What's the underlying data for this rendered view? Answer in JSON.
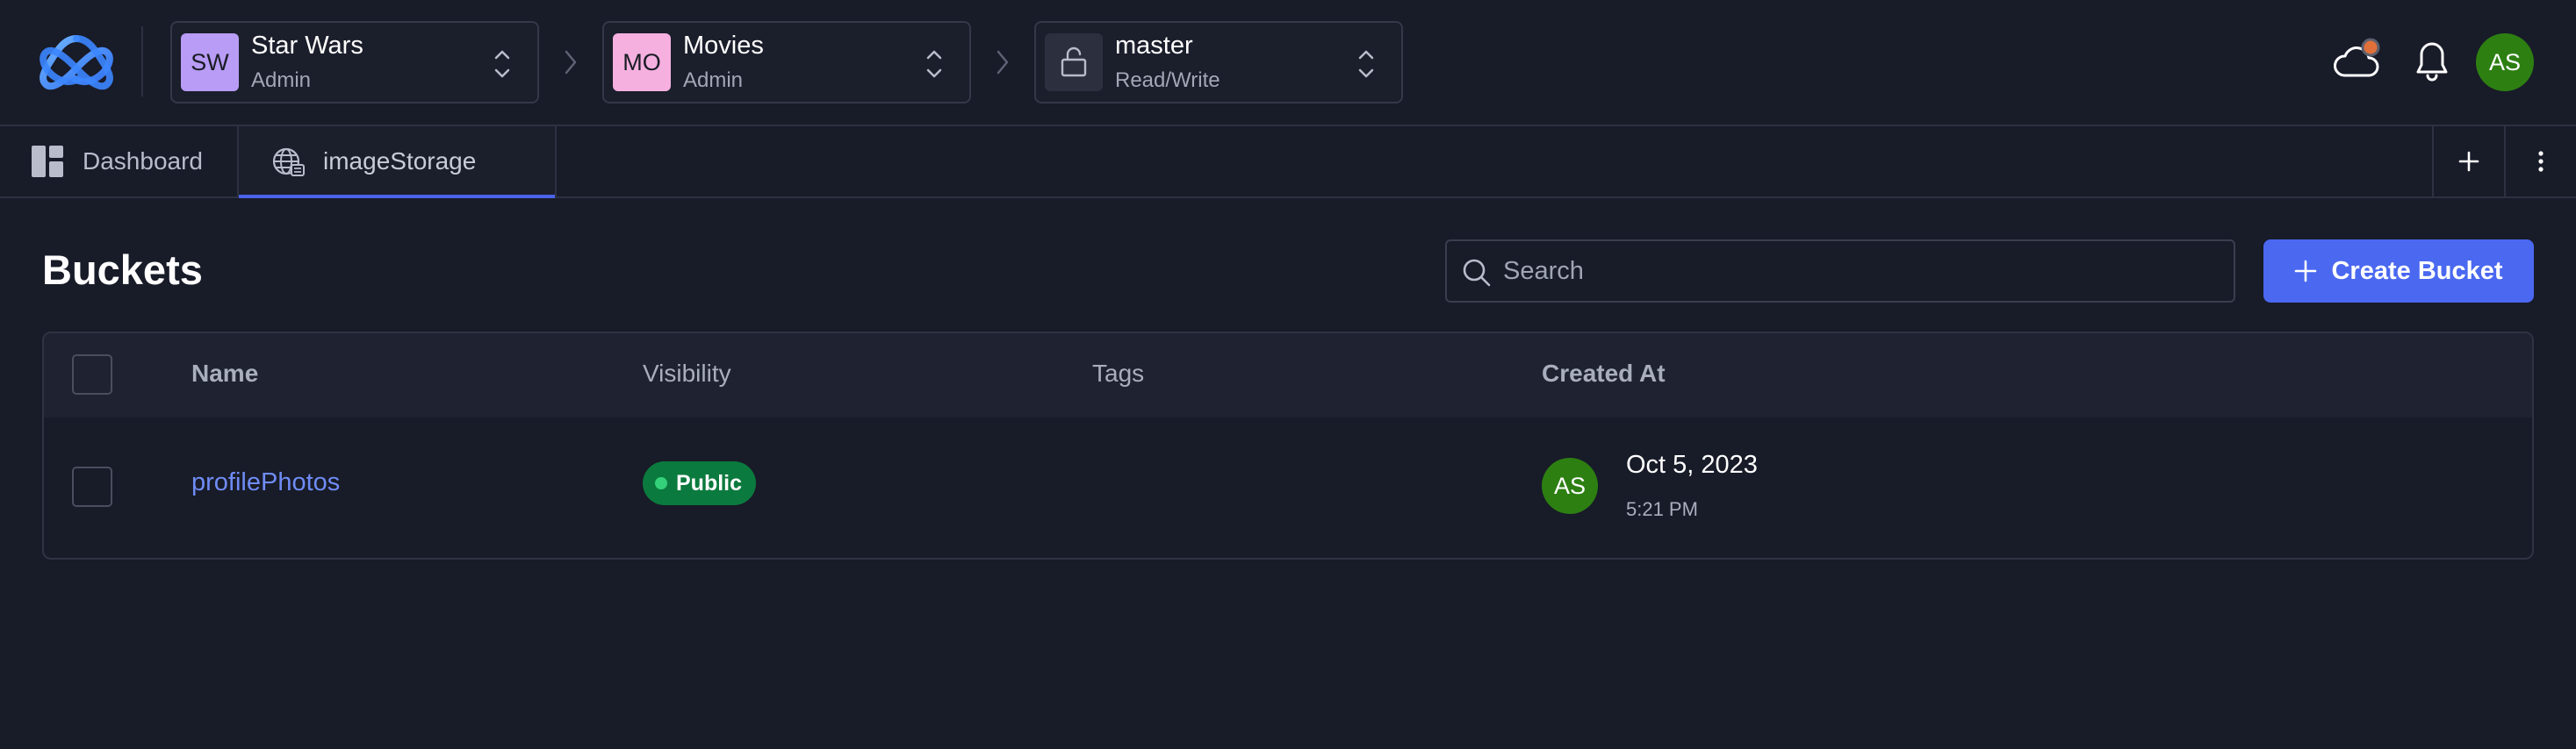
{
  "colors": {
    "background": "#181b28",
    "accent": "#4a68f0",
    "link": "#6f8cf5",
    "public_badge": "#0b7a3e",
    "user_avatar": "#2d7f12",
    "notification_dot": "#e0703a"
  },
  "header": {
    "breadcrumbs": [
      {
        "initials": "SW",
        "name": "Star Wars",
        "role": "Admin",
        "avatar_color": "#b89cf5",
        "icon": "chevron-updown-icon"
      },
      {
        "initials": "MO",
        "name": "Movies",
        "role": "Admin",
        "avatar_color": "#f5b0e0",
        "icon": "chevron-updown-icon"
      },
      {
        "icon_name": "unlock-icon",
        "name": "master",
        "role": "Read/Write"
      }
    ],
    "icons": [
      "app-logo-icon",
      "cloud-status-icon",
      "bell-icon"
    ],
    "user_initials": "AS"
  },
  "tabs": [
    {
      "label": "Dashboard",
      "icon": "dashboard-icon",
      "active": false
    },
    {
      "label": "imageStorage",
      "icon": "globe-icon",
      "active": true
    }
  ],
  "tab_actions": [
    "plus-icon",
    "more-vertical-icon"
  ],
  "main": {
    "title": "Buckets",
    "search_placeholder": "Search",
    "search_value": "",
    "create_button": "Create Bucket",
    "table": {
      "columns": [
        "Name",
        "Visibility",
        "Tags",
        "Created At"
      ],
      "rows": [
        {
          "name": "profilePhotos",
          "visibility": "Public",
          "tags": "",
          "created_by_initials": "AS",
          "created_date": "Oct 5, 2023",
          "created_time": "5:21 PM"
        }
      ]
    }
  }
}
